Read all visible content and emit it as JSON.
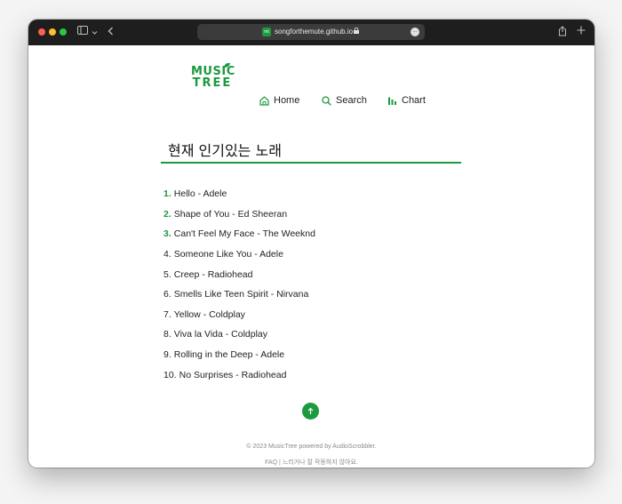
{
  "browser": {
    "url": "songforthemute.github.io",
    "favicon_text": "mt",
    "more_icon": "…"
  },
  "logo": {
    "line1": "MUSIC",
    "line2": "TREE"
  },
  "nav": [
    {
      "label": "Home",
      "icon": "home-icon"
    },
    {
      "label": "Search",
      "icon": "search-icon"
    },
    {
      "label": "Chart",
      "icon": "chart-icon"
    }
  ],
  "main": {
    "title": "현재 인기있는 노래",
    "songs": [
      {
        "rank": "1.",
        "text": "Hello - Adele",
        "highlight": true
      },
      {
        "rank": "2.",
        "text": "Shape of You - Ed Sheeran",
        "highlight": true
      },
      {
        "rank": "3.",
        "text": "Can't Feel My Face - The Weeknd",
        "highlight": true
      },
      {
        "rank": "4.",
        "text": "Someone Like You - Adele",
        "highlight": false
      },
      {
        "rank": "5.",
        "text": "Creep - Radiohead",
        "highlight": false
      },
      {
        "rank": "6.",
        "text": "Smells Like Teen Spirit - Nirvana",
        "highlight": false
      },
      {
        "rank": "7.",
        "text": "Yellow - Coldplay",
        "highlight": false
      },
      {
        "rank": "8.",
        "text": "Viva la Vida - Coldplay",
        "highlight": false
      },
      {
        "rank": "9.",
        "text": "Rolling in the Deep - Adele",
        "highlight": false
      },
      {
        "rank": "10.",
        "text": "No Surprises - Radiohead",
        "highlight": false
      }
    ]
  },
  "footer": {
    "copyright": "© 2023 MusicTree powered by AudioScrobbler.",
    "faq": "FAQ | 느리거나 잘 작동하지 않아요."
  },
  "colors": {
    "accent": "#1b9a3e",
    "titlebar": "#1e1e1e"
  }
}
